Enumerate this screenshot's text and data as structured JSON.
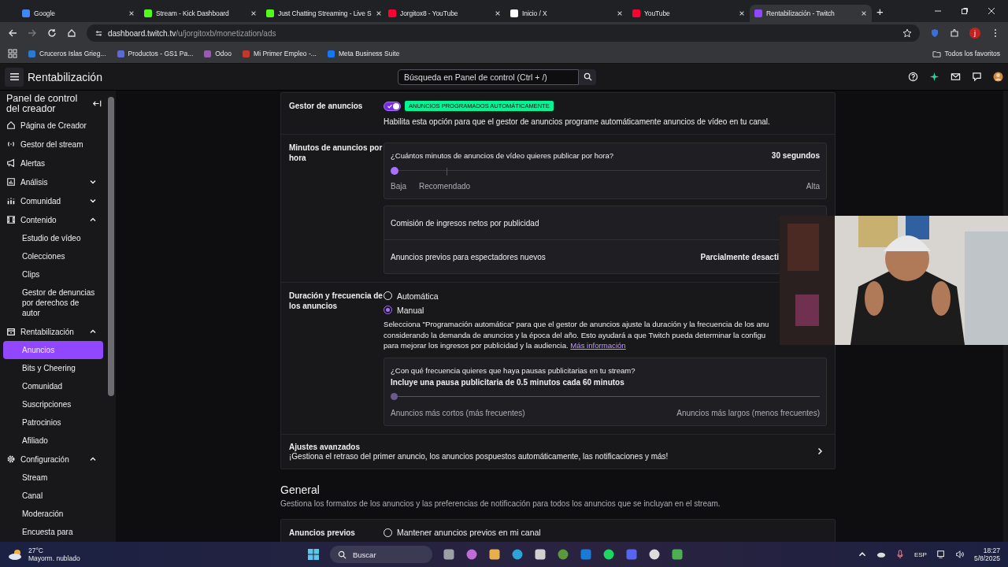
{
  "browser": {
    "tabs": [
      {
        "title": "Google",
        "selected": false
      },
      {
        "title": "Stream - Kick Dashboard",
        "selected": false
      },
      {
        "title": "Just Chatting Streaming - Live S",
        "selected": false
      },
      {
        "title": "Jorgitox8 - YouTube",
        "selected": false
      },
      {
        "title": "Inicio / X",
        "selected": false
      },
      {
        "title": "YouTube",
        "selected": false
      },
      {
        "title": "Rentabilización - Twitch",
        "selected": true
      }
    ],
    "new_tab": "+",
    "url": {
      "host": "dashboard.twitch.tv",
      "path": "/u/jorgitoxb/monetization/ads"
    },
    "profile_initial": "j",
    "bookmarks": [
      "Cruceros Islas Grieg...",
      "Productos - GS1 Pa...",
      "Odoo",
      "Mi Primer Empleo -...",
      "Meta Business Suite"
    ],
    "all_bookmarks": "Todos los favoritos"
  },
  "header": {
    "title": "Rentabilización",
    "search_placeholder": "Búsqueda en Panel de control (Ctrl + /)"
  },
  "sidebar": {
    "title": "Panel de control del creador",
    "items": [
      {
        "label": "Página de Creador",
        "selected": false
      },
      {
        "label": "Gestor del stream",
        "selected": false
      },
      {
        "label": "Alertas",
        "selected": false
      },
      {
        "label": "Análisis",
        "selected": false,
        "expanded": false
      },
      {
        "label": "Comunidad",
        "selected": false,
        "expanded": false
      },
      {
        "label": "Contenido",
        "selected": false,
        "expanded": true,
        "children": [
          {
            "label": "Estudio de vídeo",
            "selected": false
          },
          {
            "label": "Colecciones",
            "selected": false
          },
          {
            "label": "Clips",
            "selected": false
          },
          {
            "label": "Gestor de denuncias por derechos de autor",
            "selected": false
          }
        ]
      },
      {
        "label": "Rentabilización",
        "selected": false,
        "expanded": true,
        "children": [
          {
            "label": "Anuncios",
            "selected": true
          },
          {
            "label": "Bits y Cheering",
            "selected": false
          },
          {
            "label": "Comunidad",
            "selected": false
          },
          {
            "label": "Suscripciones",
            "selected": false
          },
          {
            "label": "Patrocinios",
            "selected": false
          },
          {
            "label": "Afiliado",
            "selected": false
          }
        ]
      },
      {
        "label": "Configuración",
        "selected": false,
        "expanded": true,
        "children": [
          {
            "label": "Stream",
            "selected": false
          },
          {
            "label": "Canal",
            "selected": false
          },
          {
            "label": "Moderación",
            "selected": false
          },
          {
            "label": "Encuesta para",
            "selected": false
          }
        ]
      }
    ]
  },
  "manager": {
    "label": "Gestor de anuncios",
    "on": true,
    "badge": "ANUNCIOS PROGRAMADOS AUTOMÁTICAMENTE",
    "description": "Habilita esta opción para que el gestor de anuncios programe automáticamente anuncios de vídeo en tu canal."
  },
  "minutes": {
    "label": "Minutos de anuncios por hora",
    "question": "¿Cuántos minutos de anuncios de vídeo quieres publicar por hora?",
    "reading": "30 segundos",
    "level": 0,
    "low": "Baja",
    "recommended": "Recomendado",
    "high": "Alta",
    "rows": [
      {
        "label": "Comisión de ingresos netos por publicidad"
      },
      {
        "label": "Anuncios previos para espectadores nuevos",
        "value": "Parcialmente desacti"
      }
    ]
  },
  "duration": {
    "label": "Duración y frecuencia de los anuncios",
    "options": [
      {
        "label": "Automática",
        "selected": false
      },
      {
        "label": "Manual",
        "selected": true
      }
    ],
    "description_lines": [
      "Selecciona \"Programación automática\" para que el gestor de anuncios ajuste la duración y la frecuencia de los anu",
      "considerando la demanda de anuncios y la época del año. Esto ayudará a que Twitch pueda determinar la configu",
      "para mejorar los ingresos por publicidad y la audiencia."
    ],
    "link": "Más información",
    "question": "¿Con qué frecuencia quieres que haya pausas publicitarias en tu stream?",
    "summary": "Incluye una pausa publicitaria de 0.5 minutos cada 60 minutos",
    "level": 0,
    "low": "Anuncios más cortos (más frecuentes)",
    "high": "Anuncios más largos (menos frecuentes)"
  },
  "advanced": {
    "title": "Ajustes avanzados",
    "description": "¡Gestiona el retraso del primer anuncio, los anuncios pospuestos automáticamente, las notificaciones y más!"
  },
  "general": {
    "title": "General",
    "description": "Gestiona los formatos de los anuncios y las preferencias de notificación para todos los anuncios que se incluyan en el stream.",
    "rows": [
      {
        "label": "Anuncios previos",
        "options": [
          {
            "label": "Mantener anuncios previos en mi canal",
            "selected": false
          }
        ]
      }
    ]
  },
  "taskbar": {
    "temperature": "27°C",
    "condition": "Mayorm. nublado",
    "search_placeholder": "Buscar",
    "language": "ESP",
    "time": "18:27",
    "date": "5/8/2025"
  }
}
